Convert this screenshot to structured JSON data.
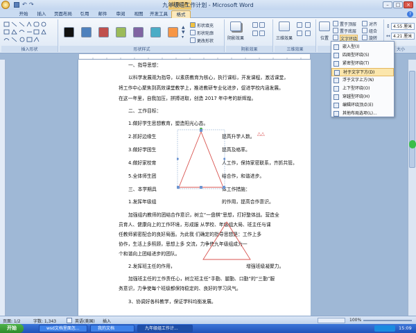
{
  "window": {
    "title": "九年级组工作计划 - Microsoft Word",
    "context_tab": "绘图工具"
  },
  "tabs": [
    "开始",
    "插入",
    "页面布局",
    "引用",
    "邮件",
    "审阅",
    "视图",
    "开发工具",
    "格式"
  ],
  "ribbon": {
    "groups": [
      "插入形状",
      "形状样式",
      "阴影效果",
      "三维效果",
      "排列",
      "大小"
    ],
    "shape_style_buttons": [
      "形状填充",
      "形状轮廓",
      "更改形状"
    ],
    "shadow_label": "阴影效果",
    "threed_label": "三维效果",
    "position_label": "位置",
    "arrange_buttons": [
      "置于顶层",
      "置于底层",
      "文字环绕",
      "对齐",
      "组合",
      "旋转"
    ],
    "size": {
      "height": "4.55 厘米",
      "width": "4.21 厘米"
    },
    "swatch_colors": [
      "#111111",
      "#4e81bd",
      "#c0504d",
      "#9bbb59",
      "#8064a2",
      "#4bacc6",
      "#f79646"
    ]
  },
  "wrap_menu": {
    "items": [
      "嵌入型(I)",
      "四周型环绕(S)",
      "紧密型环绕(T)",
      "衬于文字下方(D)",
      "浮于文字上方(N)",
      "上下型环绕(O)",
      "穿越型环绕(H)",
      "编辑环绕顶点(E)",
      "其他布局选项(L)..."
    ],
    "highlighted_index": 3
  },
  "document": {
    "lines": [
      "一、指导思想：",
      "以科学发展观为指导，以素质教育为核心，执行课标，开发课程，激活课堂，",
      "将工作中心聚焦到高效课堂教学上，推进教研专业化进步，促进学校内涵发展。",
      "在这一年里，自我加压，拼搏进取，创造 2017 年中考的新辉煌。",
      "二、工作目标：",
      "1.做好学生思想教育，塑造阳光心态。",
      "2.抓好边缘生",
      "提高升学人数。",
      "3.做好学困生",
      "提高及格率。",
      "4.做好家校育",
      "人工作，保持家密联系，齐抓共管。",
      "5.全体师生团",
      "结合作，和谐进步。",
      "三、本学期具",
      "体工作措施：",
      "1.发挥年级组",
      "的作用，提高合作意识。",
      "加强组内教师的团结合作意识，树立“一盘棋”思想，打好整体战。营造全",
      "员育人、健康向上的工作环境，形成服      从学校、年级组大局、班主任与课",
      "任教师紧密配合的良好局面。为此我            们确定的指导思想是：工作上多",
      "协作，生活上多照顾，思想上多                交流，力争使九年级组成为一",
      "个和谐向上团结进步的团队。",
      "2.发挥班主任的作用，",
      "增强班级凝聚力。",
      "加强班主任的工作责任心，树立班主任“手勤、腿勤、口勤”的“三勤”服",
      "务意识，力争使每个班级都保持稳定的、良好的学习风气。",
      "3、协调好各科教学，保证学科均衡发展。"
    ]
  },
  "status": {
    "page": "页面: 1/2",
    "words": "字数: 1,343",
    "lang": "英语(美国)",
    "mode": "插入",
    "zoom": "100%"
  },
  "taskbar": {
    "start": "开始",
    "tasks": [
      "wsd文档里面怎...",
      "我的文档",
      "九年级组工作计..."
    ],
    "time": "15:09"
  }
}
